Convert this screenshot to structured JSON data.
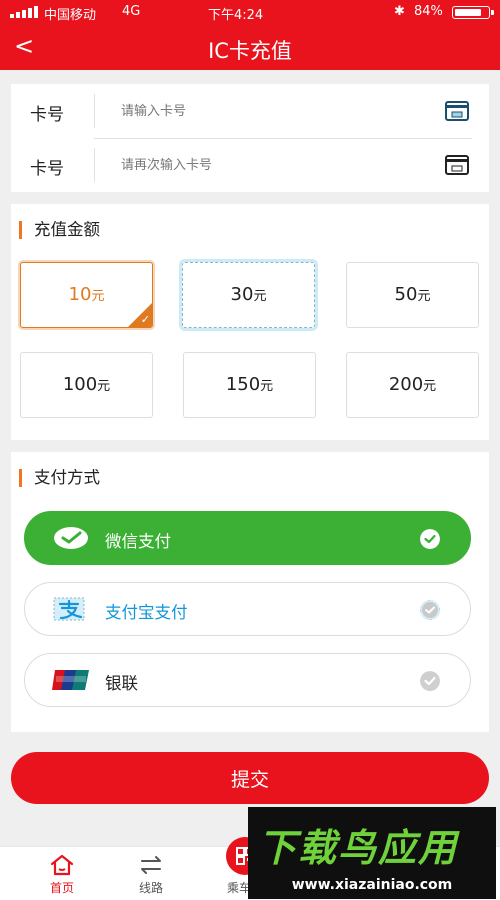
{
  "status_bar": {
    "carrier": "中国移动",
    "network": "4G",
    "time": "下午4:24",
    "battery": "84%",
    "battery_level": 0.84
  },
  "header": {
    "back": "<",
    "title": "IC卡充值"
  },
  "card_inputs": [
    {
      "label": "卡号",
      "placeholder": "请输入卡号",
      "value": ""
    },
    {
      "label": "卡号",
      "placeholder": "请再次输入卡号",
      "value": ""
    }
  ],
  "amount_section": {
    "title": "充值金额",
    "unit": "元",
    "options": [
      "10",
      "30",
      "50",
      "100",
      "150",
      "200"
    ],
    "selected": "10"
  },
  "payment_section": {
    "title": "支付方式",
    "methods": [
      {
        "label": "微信支付",
        "icon": "wechat-pay-icon",
        "selected": true
      },
      {
        "label": "支付宝支付",
        "icon": "alipay-icon",
        "selected": false
      },
      {
        "label": "银联",
        "icon": "unionpay-icon",
        "selected": false
      }
    ]
  },
  "submit_label": "提交",
  "tabbar": [
    {
      "label": "首页",
      "icon": "home-icon",
      "active": true
    },
    {
      "label": "线路",
      "icon": "route-icon",
      "active": false
    },
    {
      "label": "乘车码",
      "icon": "qr-code-icon",
      "active": false
    }
  ],
  "watermark": {
    "text": "下载鸟应用",
    "url": "www.xiazainiao.com"
  },
  "colors": {
    "brand_red": "#e8131c",
    "accent_orange": "#e07a21",
    "wechat_green": "#3cb034",
    "alipay_blue": "#1296db"
  }
}
